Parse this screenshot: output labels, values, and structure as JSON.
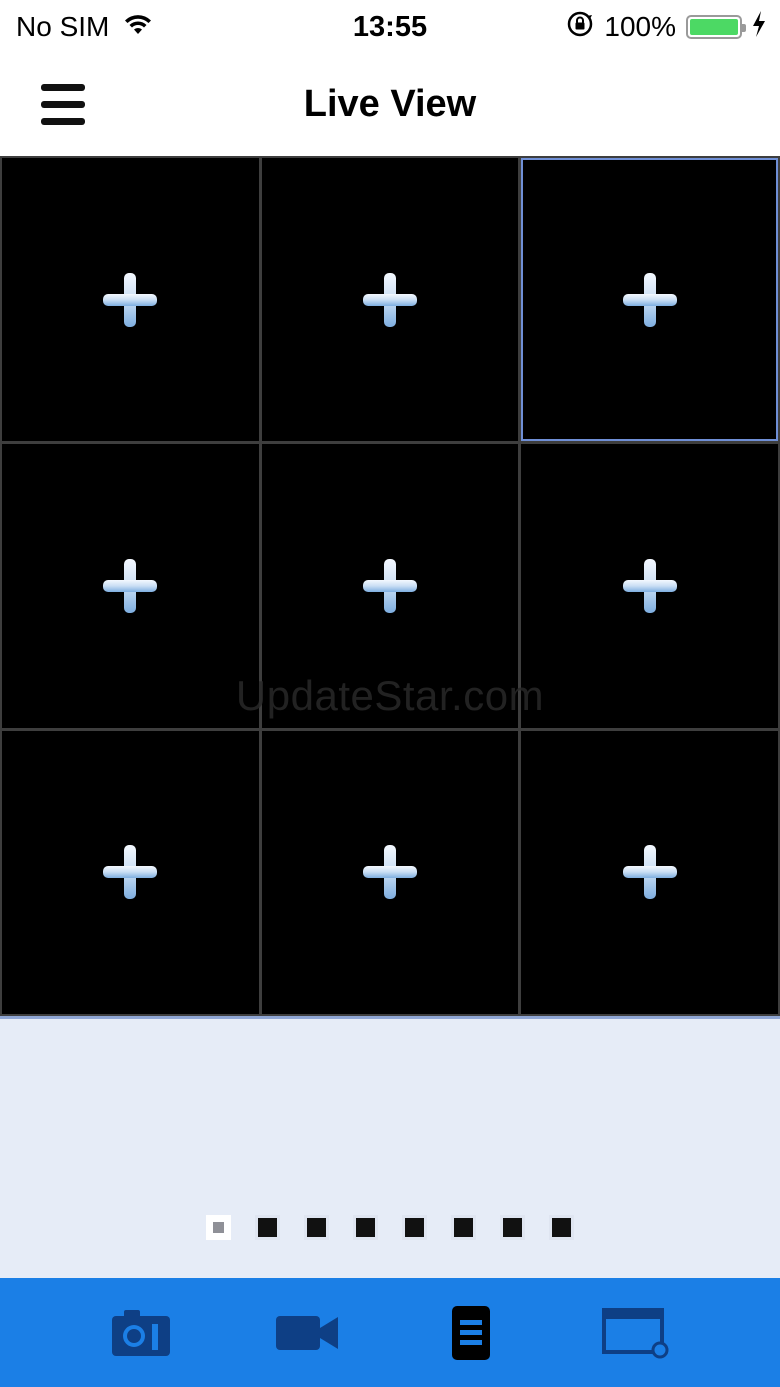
{
  "status_bar": {
    "carrier": "No SIM",
    "time": "13:55",
    "battery_percent": "100%",
    "battery_level": 1.0,
    "icons": [
      "wifi-icon",
      "orientation-lock-icon",
      "battery-icon",
      "charging-bolt-icon"
    ]
  },
  "nav": {
    "title": "Live View",
    "menu_icon": "hamburger-menu-icon"
  },
  "grid": {
    "rows": 3,
    "columns": 3,
    "selected_index": 2,
    "cell_icon": "add-camera-plus-icon"
  },
  "watermark": "UpdateStar.com",
  "pagination": {
    "total_pages": 8,
    "current_page": 1
  },
  "tab_bar": {
    "tabs": [
      "snapshot-camera-icon",
      "record-video-icon",
      "list-menu-icon",
      "window-playback-icon"
    ]
  },
  "colors": {
    "tab_bar": "#1b7fe6",
    "tab_icon": "#0e3f85",
    "selected_border": "#6f8fd6",
    "control_bg": "#e6ecf7",
    "battery_green": "#4cd964"
  }
}
